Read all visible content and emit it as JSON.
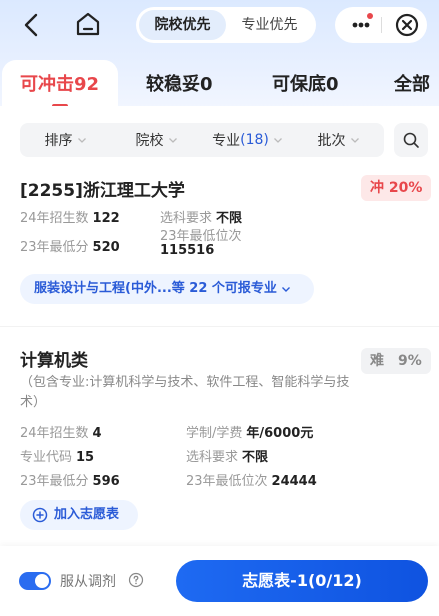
{
  "nav": {
    "segments": [
      "院校优先",
      "专业优先"
    ],
    "active_segment": 0
  },
  "categories": [
    {
      "label": "可冲击92",
      "active": true
    },
    {
      "label": "较稳妥0",
      "active": false
    },
    {
      "label": "可保底0",
      "active": false
    },
    {
      "label": "全部",
      "active": false
    }
  ],
  "filters": {
    "sort": "排序",
    "school": "院校",
    "major_label": "专业",
    "major_count": "(18)",
    "batch": "批次"
  },
  "school": {
    "title": "[2255]浙江理工大学",
    "tag": "冲 20%",
    "enroll_label": "24年招生数",
    "enroll_value": "122",
    "subject_label": "选科要求",
    "subject_value": "不限",
    "minscore_label": "23年最低分",
    "minscore_value": "520",
    "minrank_label": "23年最低位次",
    "minrank_value": "115516",
    "majors_pill": "服装设计与工程(中外...等 22 个可报专业"
  },
  "major": {
    "title": "计算机类",
    "tag": "难　9%",
    "desc": "（包含专业:计算机科学与技术、软件工程、智能科学与技术）",
    "enroll_label": "24年招生数",
    "enroll_value": "4",
    "fee_label": "学制/学费",
    "fee_value": "年/6000元",
    "code_label": "专业代码",
    "code_value": "15",
    "subject_label": "选科要求",
    "subject_value": "不限",
    "minscore_label": "23年最低分",
    "minscore_value": "596",
    "minrank_label": "23年最低位次",
    "minrank_value": "24444",
    "add_label": "加入志愿表"
  },
  "bottom": {
    "toggle_label": "服从调剂",
    "toggle_on": true,
    "primary_label": "志愿表-1(0/12)"
  },
  "colors": {
    "accent_blue": "#2a6cf0",
    "accent_red": "#e8474b"
  }
}
